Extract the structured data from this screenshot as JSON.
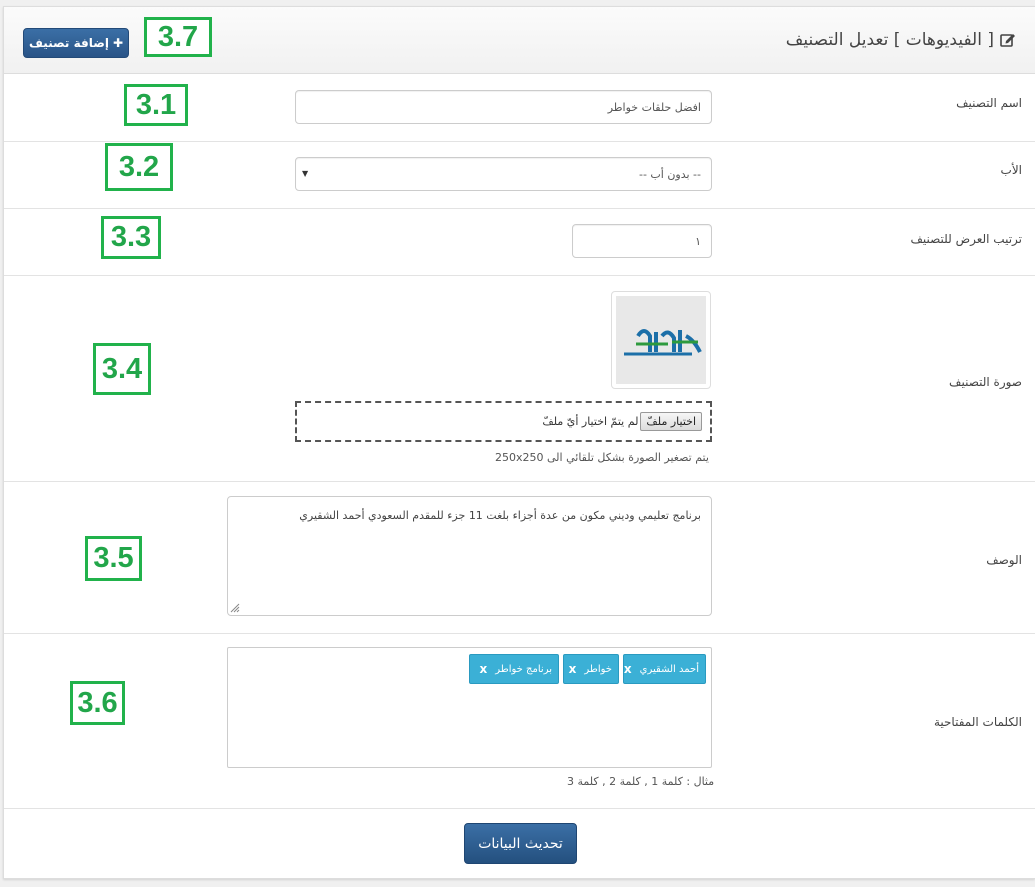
{
  "header": {
    "title": "[ الفيديوهات ] تعديل التصنيف",
    "edit_icon": "edit-icon",
    "add_button_label": "إضافة تصنيف",
    "add_button_icon": "plus-icon"
  },
  "annotations": {
    "a1": "3.1",
    "a2": "3.2",
    "a3": "3.3",
    "a4": "3.4",
    "a5": "3.5",
    "a6": "3.6",
    "a7": "3.7",
    "color": "#21b24b"
  },
  "form": {
    "name": {
      "label": "اسم التصنيف",
      "value": "افضل حلقات خواطر"
    },
    "parent": {
      "label": "الأب",
      "value": "-- بدون أب --"
    },
    "order": {
      "label": "ترتيب العرض للتصنيف",
      "value": "١"
    },
    "image": {
      "label": "صورة التصنيف",
      "choose_button": "اختيار ملفّ",
      "no_file_text": "لم يتمّ اختيار أيّ ملفّ",
      "help": "يتم تصغير الصورة بشكل تلقائي الى 250x250",
      "thumb_text": "خواطر"
    },
    "description": {
      "label": "الوصف",
      "value": "برنامج تعليمي وديني مكون من عدة أجزاء بلغت 11 جزء للمقدم السعودي أحمد الشقيري"
    },
    "keywords": {
      "label": "الكلمات المفتاحية",
      "tags": [
        "أحمد الشقيري",
        "خواطر",
        "برنامج خواطر"
      ],
      "remove_symbol": "x",
      "help": "مثال : كلمة 1 , كلمة 2 , كلمة 3"
    },
    "submit_label": "تحديث البيانات"
  },
  "colors": {
    "primary_button": "#2f5f95",
    "tag": "#3bb0d6"
  }
}
